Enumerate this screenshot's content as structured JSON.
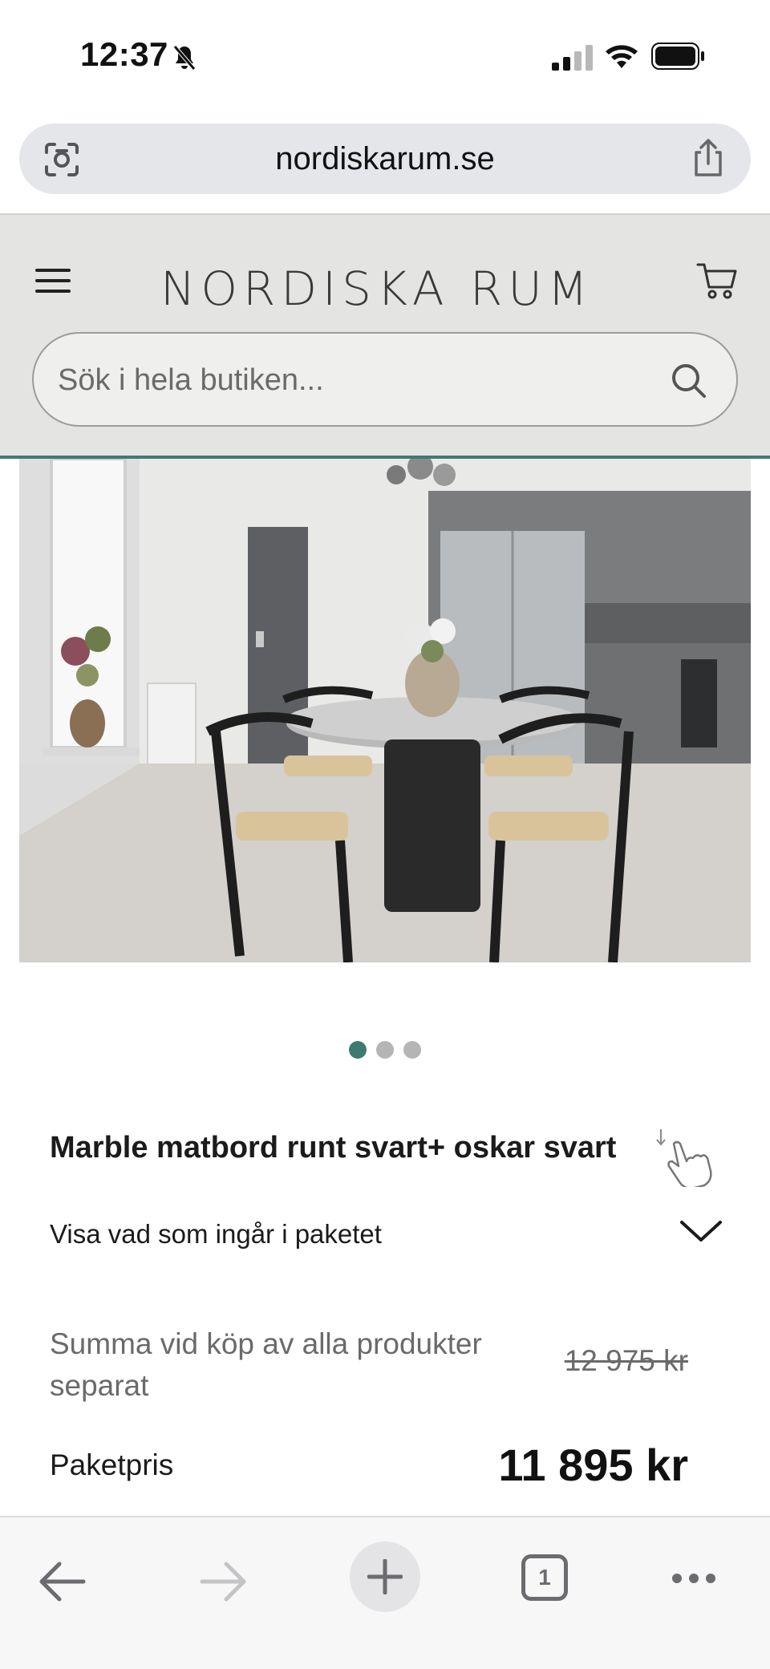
{
  "status_bar": {
    "time": "12:37"
  },
  "browser": {
    "url": "nordiskarum.se"
  },
  "site": {
    "logo_text": "NORDISKA RUM",
    "search_placeholder": "Sök i hela butiken...",
    "accent_color": "#3f7a71"
  },
  "gallery": {
    "slides": 3,
    "active_index": 0
  },
  "product": {
    "title": "Marble matbord runt svart+ oskar svart",
    "package_toggle_label": "Visa vad som ingår i paketet",
    "separate_label": "Summa vid köp av alla produkter separat",
    "separate_price": "12 975 kr",
    "package_price_label": "Paketpris",
    "package_price": "11 895 kr"
  },
  "toolbar": {
    "tab_count": "1"
  }
}
